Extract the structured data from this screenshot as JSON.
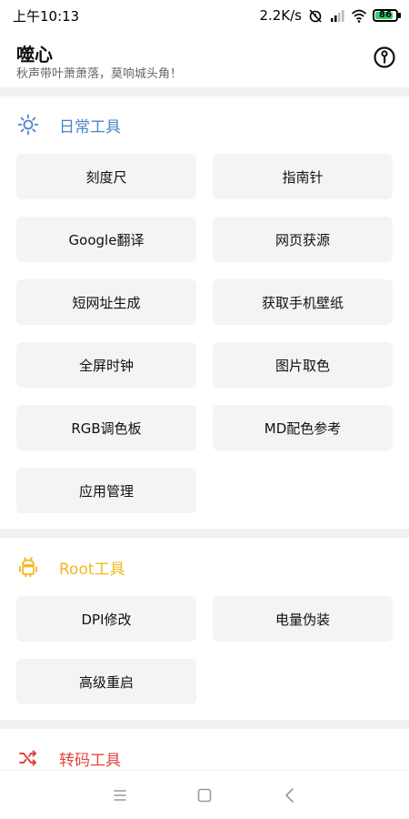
{
  "status_bar": {
    "time": "上午10:13",
    "net_speed": "2.2K/s",
    "battery": "86",
    "battery_level_percent": 86
  },
  "header": {
    "title": "噬心",
    "subtitle": "秋声带叶萧萧落，莫响城头角！",
    "info_icon": "info-circle-icon"
  },
  "sections": [
    {
      "title": "日常工具",
      "icon": "sun-icon",
      "color": "#4a86c8",
      "tools": [
        "刻度尺",
        "指南针",
        "Google翻译",
        "网页获源",
        "短网址生成",
        "获取手机壁纸",
        "全屏时钟",
        "图片取色",
        "RGB调色板",
        "MD配色参考",
        "应用管理"
      ]
    },
    {
      "title": "Root工具",
      "icon": "android-icon",
      "color": "#f3b81c",
      "tools": [
        "DPI修改",
        "电量伪装",
        "高级重启"
      ]
    },
    {
      "title": "转码工具",
      "icon": "shuffle-icon",
      "color": "#e0453a",
      "tools": []
    }
  ],
  "nav_bar": {
    "menu_icon": "menu-icon",
    "home_icon": "home-square-icon",
    "back_icon": "back-chevron-icon"
  }
}
